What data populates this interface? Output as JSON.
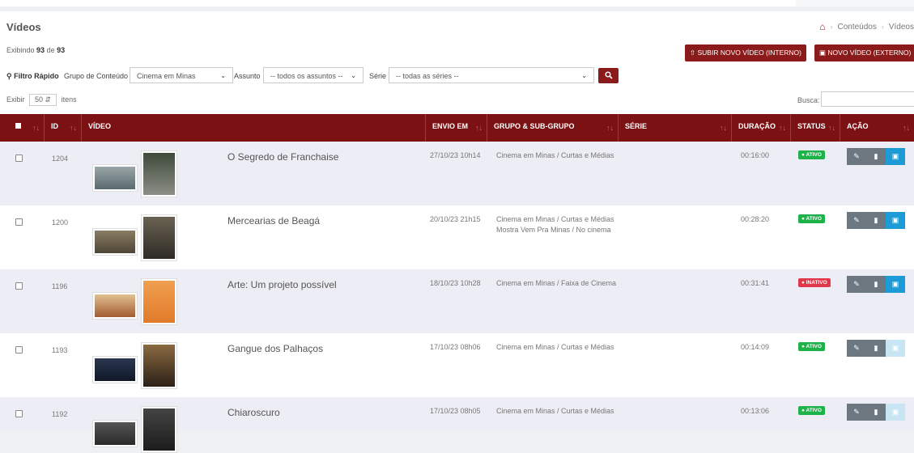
{
  "page": {
    "title": "Vídeos",
    "breadcrumb": [
      "Conteúdos",
      "Vídeos"
    ],
    "showing_prefix": "Exibindo",
    "showing_count": "93",
    "showing_sep": "de",
    "showing_total": "93"
  },
  "buttons": {
    "upload_internal": "SUBIR NOVO VÍDEO (INTERNO)",
    "new_external": "NOVO VÍDEO (EXTERNO)"
  },
  "filters": {
    "quick_filter": "Filtro Rápido",
    "group_label": "Grupo de Conteúdo",
    "group_value": "Cinema em Minas",
    "subject_label": "Assunto",
    "subject_value": "-- todos os assuntos --",
    "series_label": "Série",
    "series_value": "-- todas as séries --"
  },
  "table_controls": {
    "show_label": "Exibir",
    "show_value": "50",
    "items_label": "itens",
    "search_label": "Busca:"
  },
  "columns": [
    "ID",
    "VÍDEO",
    "ENVIO EM",
    "GRUPO & SUB-GRUPO",
    "SÉRIE",
    "DURAÇÃO",
    "STATUS",
    "AÇÃO"
  ],
  "rows": [
    {
      "id": "1204",
      "title": "O Segredo de Franchaise",
      "sent": "27/10/23 10h14",
      "group": "Cinema em Minas / Curtas e Médias",
      "group2": "",
      "series": "",
      "duration": "00:16:00",
      "status": "ATIVO",
      "active": true,
      "save_enabled": true
    },
    {
      "id": "1200",
      "title": "Mercearias de Beagá",
      "sent": "20/10/23 21h15",
      "group": "Cinema em Minas / Curtas e Médias",
      "group2": "Mostra Vem Pra Minas / No cinema",
      "series": "",
      "duration": "00:28:20",
      "status": "ATIVO",
      "active": true,
      "save_enabled": true
    },
    {
      "id": "1196",
      "title": "Arte: Um projeto possível",
      "sent": "18/10/23 10h28",
      "group": "Cinema em Minas / Faixa de Cinema",
      "group2": "",
      "series": "",
      "duration": "00:31:41",
      "status": "INATIVO",
      "active": false,
      "save_enabled": true
    },
    {
      "id": "1193",
      "title": "Gangue dos Palhaços",
      "sent": "17/10/23 08h06",
      "group": "Cinema em Minas / Curtas e Médias",
      "group2": "",
      "series": "",
      "duration": "00:14:09",
      "status": "ATIVO",
      "active": true,
      "save_enabled": false
    },
    {
      "id": "1192",
      "title": "Chiaroscuro",
      "sent": "17/10/23 08h05",
      "group": "Cinema em Minas / Curtas e Médias",
      "group2": "",
      "series": "",
      "duration": "00:13:06",
      "status": "ATIVO",
      "active": true,
      "save_enabled": false
    }
  ],
  "colors": {
    "brand": "#7b1113",
    "active": "#1eb34a",
    "inactive": "#e0384a",
    "row_alt": "#ededf5"
  }
}
